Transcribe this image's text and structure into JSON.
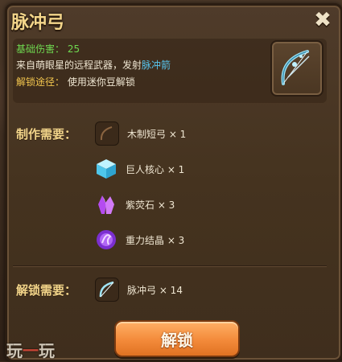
{
  "dialog": {
    "title": "脉冲弓",
    "close_label": "✖",
    "stat_label": "基础伤害：",
    "stat_value": "25",
    "desc_prefix": "来自萌眼星的远程武器，发射",
    "desc_highlight": "脉冲箭",
    "unlock_path_label": "解锁途径：",
    "unlock_path_value": "使用迷你豆解锁",
    "item_icon": "pulse-bow-icon"
  },
  "craft": {
    "label": "制作需要：",
    "materials": [
      {
        "name": "木制短弓 × 1",
        "icon": "wooden-bow-icon"
      },
      {
        "name": "巨人核心 × 1",
        "icon": "giant-core-cube-icon"
      },
      {
        "name": "紫荧石 × 3",
        "icon": "purple-crystal-icon"
      },
      {
        "name": "重力结晶 × 3",
        "icon": "gravity-crystal-icon"
      }
    ]
  },
  "unlock_req": {
    "label": "解锁需要：",
    "item": "脉冲弓 × 14",
    "icon": "pulse-bow-fragment-icon"
  },
  "button": {
    "unlock_label": "解锁"
  },
  "watermark": {
    "text_a": "玩",
    "text_b": "一",
    "text_c": "玩"
  },
  "colors": {
    "title": "#f3d58a",
    "stat": "#6fd850",
    "highlight": "#58c7f0",
    "button": "#f38a3a"
  }
}
